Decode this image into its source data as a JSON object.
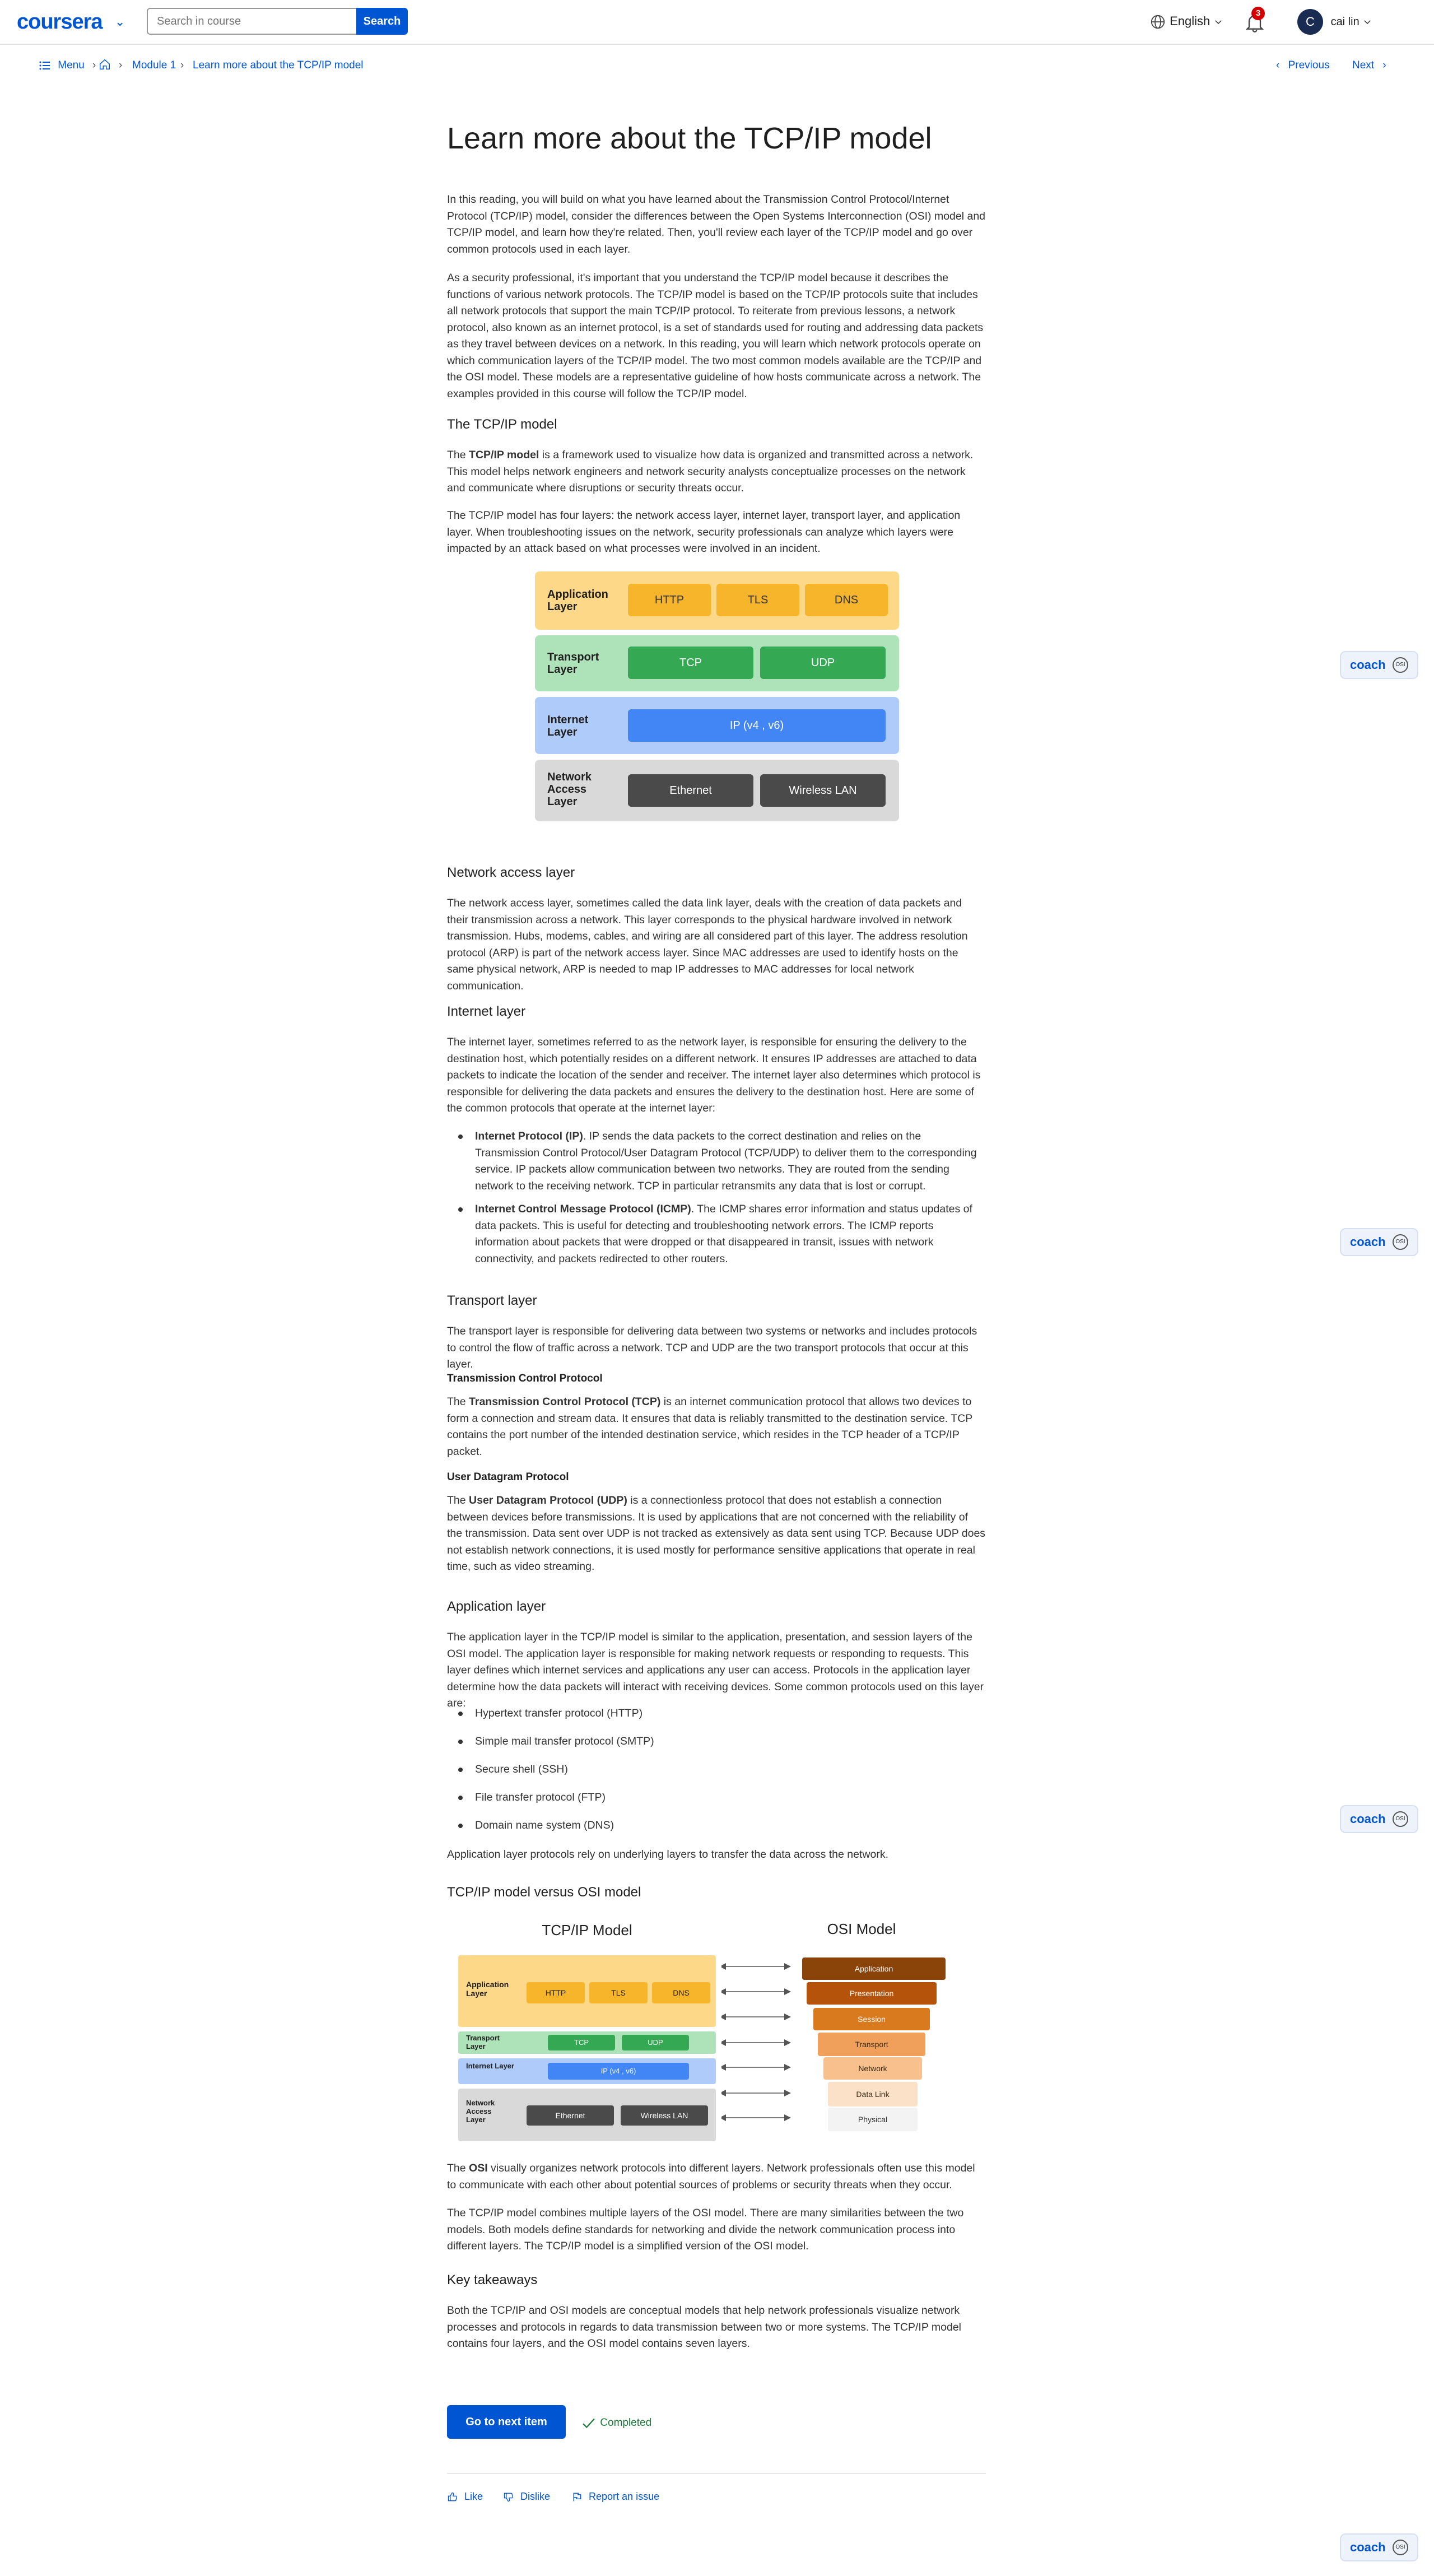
{
  "header": {
    "logo": "coursera",
    "search_placeholder": "Search in course",
    "search_button": "Search",
    "language": "English",
    "notification_count": "3",
    "user_initial": "C",
    "user_name": "cai lin"
  },
  "subnav": {
    "menu": "Menu",
    "breadcrumb_module": "Module 1",
    "breadcrumb_current": "Learn more about the TCP/IP model",
    "previous": "Previous",
    "next": "Next"
  },
  "article": {
    "title": "Learn more about the TCP/IP model",
    "intro_1": "In this reading, you will build on what you have learned about the Transmission Control Protocol/Internet Protocol (TCP/IP) model, consider the differences between the Open Systems Interconnection (OSI) model and TCP/IP model, and learn how they're related. Then, you'll review each layer of the TCP/IP model and go over common protocols used in each layer.",
    "intro_2": "As a security professional, it's important that you understand the TCP/IP model because it describes the functions of various network protocols. The TCP/IP model is based on the TCP/IP protocols suite that includes all network protocols that support the main TCP/IP protocol. To reiterate from previous lessons, a network protocol, also known as an internet protocol, is a set of standards used for routing and addressing data packets as they travel between devices on a network. In this reading, you will learn which network protocols operate on which communication layers of the TCP/IP model. The two most common models available are the TCP/IP and the OSI model. These models are a representative guideline of how hosts communicate across a network. The examples provided in this course will follow the TCP/IP model.",
    "h_tcpip": "The TCP/IP model",
    "tcpip_p1_bold": "TCP/IP model",
    "tcpip_p1_pre": "The ",
    "tcpip_p1_rest": " is a framework used to visualize how data is organized and transmitted across a network. This model helps network engineers and network security analysts conceptualize processes on the network and communicate where disruptions or security threats occur.",
    "tcpip_p2": "The TCP/IP model has four layers: the network access layer, internet layer, transport layer, and application layer. When troubleshooting issues on the network, security professionals can analyze which layers were impacted by an attack based on what processes were involved in an incident.",
    "h_network_access": "Network access layer",
    "network_access_p": "The network access layer, sometimes called the data link layer, deals with the creation of data packets and their transmission across a network. This layer corresponds to the physical hardware involved in network transmission. Hubs, modems, cables, and wiring are all considered part of this layer. The address resolution protocol (ARP) is part of the network access layer. Since MAC addresses are used to identify hosts on the same physical network, ARP is needed to map IP addresses to MAC addresses for local network communication.",
    "h_internet": "Internet layer",
    "internet_p": "The internet layer, sometimes referred to as the network layer, is responsible for ensuring the delivery to the destination host, which potentially resides on a different network. It ensures IP addresses are attached to data packets to indicate the location of the sender and receiver. The internet layer also determines which protocol is responsible for delivering the data packets and ensures the delivery to the destination host. Here are some of the common protocols that operate at the internet layer:",
    "ip_bold": "Internet Protocol (IP)",
    "ip_rest": ". IP sends the data packets to the correct destination and relies on the Transmission Control Protocol/User Datagram Protocol (TCP/UDP) to deliver them to the corresponding service. IP packets allow communication between two networks. They are routed from the sending network to the receiving network. TCP in particular retransmits any data that is lost or corrupt.",
    "icmp_bold": "Internet Control Message Protocol (ICMP)",
    "icmp_rest": ". The ICMP shares error information and status updates of data packets. This is useful for detecting and troubleshooting network errors. The ICMP reports information about packets that were dropped or that disappeared in transit, issues with network connectivity, and packets redirected to other routers.",
    "h_transport": "Transport layer",
    "transport_p": "The transport layer is responsible for delivering data between two systems or networks and includes protocols to control the flow of traffic across a network. TCP and UDP are the two transport protocols that occur at this layer.",
    "h3_tcp": "Transmission Control Protocol",
    "tcp_pre": "The ",
    "tcp_bold": "Transmission Control Protocol (TCP)",
    "tcp_rest": " is an internet communication protocol that allows two devices to form a connection and stream data. It ensures that data is reliably transmitted to the destination service. TCP contains the port number of the intended destination service, which resides in the TCP header of a TCP/IP packet.",
    "h3_udp": "User Datagram Protocol",
    "udp_pre": "The ",
    "udp_bold": "User Datagram Protocol (UDP)",
    "udp_rest": " is a connectionless protocol that does not establish a connection between devices before transmissions. It is used by applications that are not concerned with the reliability of the transmission. Data sent over UDP is not tracked as extensively as data sent using TCP. Because UDP does not establish network connections, it is used mostly for performance sensitive applications that operate in real time, such as video streaming.",
    "h_application": "Application layer",
    "application_p": "The application layer in the TCP/IP model is similar to the application, presentation, and session layers of the OSI model. The application layer is responsible for making network requests or responding to requests. This layer defines which internet services and applications any user can access. Protocols in the application layer determine how the data packets will interact with receiving devices. Some common protocols used on this layer are:",
    "app_protocols": [
      "Hypertext transfer protocol (HTTP)",
      "Simple mail transfer protocol (SMTP)",
      "Secure shell (SSH)",
      "File transfer protocol (FTP)",
      "Domain name system (DNS)"
    ],
    "application_after": "Application layer protocols rely on underlying layers to transfer the data across the network.",
    "h_versus": "TCP/IP model versus OSI model",
    "osi_bold": "OSI",
    "osi_pre": "The ",
    "osi_rest": " visually organizes network protocols into different layers. Network professionals often use this model to communicate with each other about potential sources of problems or security threats when they occur.",
    "versus_p2": "The TCP/IP model combines multiple layers of the OSI model. There are many similarities between the two models. Both models define standards for networking and divide the network communication process into different layers. The TCP/IP model is a simplified version of the OSI model.",
    "h_takeaways": "Key takeaways",
    "takeaways_p": "Both the TCP/IP and OSI models are conceptual models that help network professionals visualize network processes and protocols in regards to data transmission between two or more systems. The TCP/IP model contains four layers, and the OSI model contains seven layers."
  },
  "diagram1": {
    "layers": [
      {
        "name": "Application Layer",
        "protocols": [
          "HTTP",
          "TLS",
          "DNS"
        ]
      },
      {
        "name": "Transport Layer",
        "protocols": [
          "TCP",
          "UDP"
        ]
      },
      {
        "name": "Internet Layer",
        "protocols": [
          "IP (v4 , v6)"
        ]
      },
      {
        "name": "Network Access Layer",
        "protocols": [
          "Ethernet",
          "Wireless LAN"
        ]
      }
    ],
    "colors": {
      "app_bg": "#fdd888",
      "app_chip": "#f7b52c",
      "trans_bg": "#aee2b9",
      "trans_chip": "#34a853",
      "inet_bg": "#aecbfa",
      "inet_chip": "#4285f4",
      "net_bg": "#d9d9d9",
      "net_chip": "#4a4a4a"
    }
  },
  "diagram2": {
    "tcpip_title": "TCP/IP Model",
    "osi_title": "OSI Model",
    "osi_layers": [
      "Application",
      "Presentation",
      "Session",
      "Transport",
      "Network",
      "Data Link",
      "Physical"
    ],
    "osi_colors": [
      "#8a4309",
      "#b45309",
      "#d97a1e",
      "#f0a05a",
      "#f8c08c",
      "#fbe1c8",
      "#f3f3f3"
    ]
  },
  "footer": {
    "next_item": "Go to next item",
    "completed": "Completed",
    "like": "Like",
    "dislike": "Dislike",
    "report": "Report an issue"
  },
  "coach": {
    "label": "coach",
    "badge": "OSI"
  }
}
